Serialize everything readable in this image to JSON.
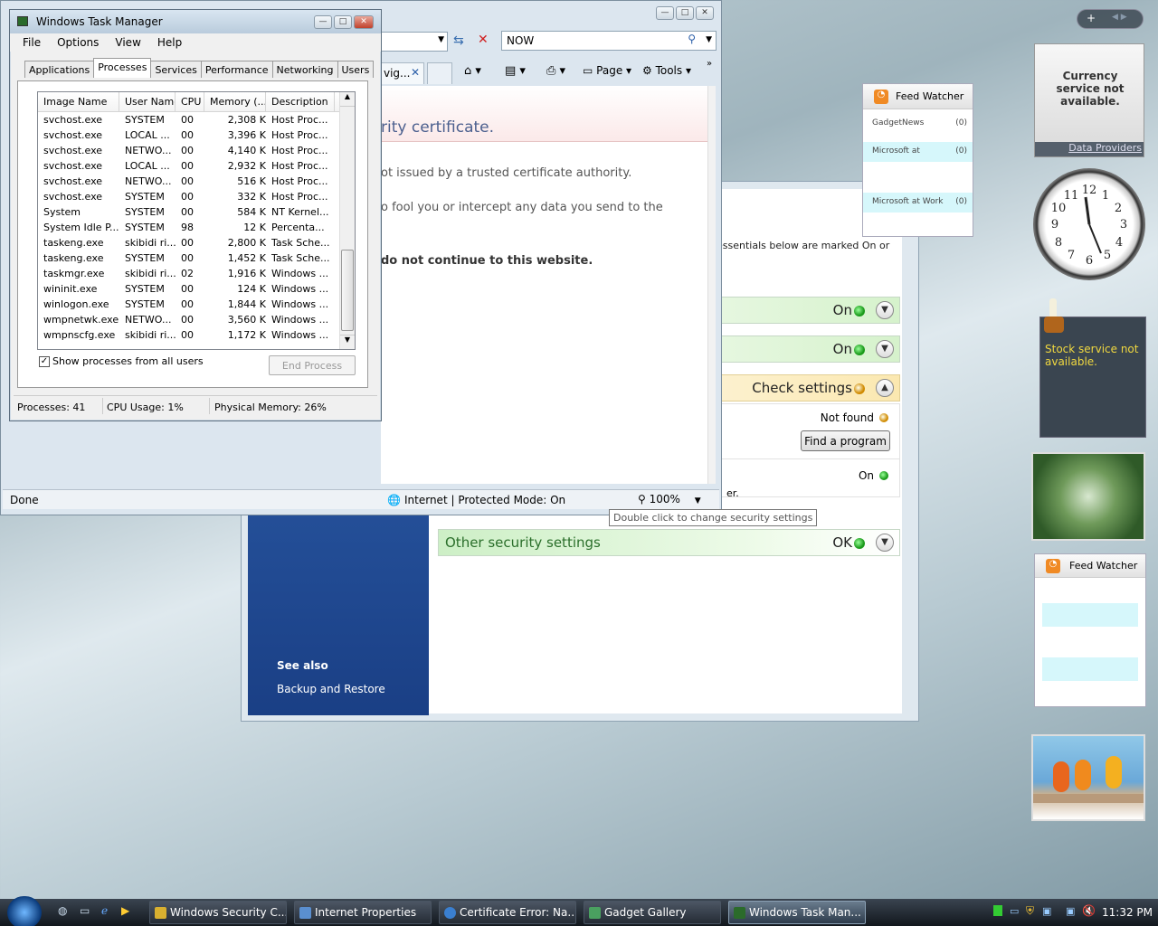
{
  "security_center": {
    "header_fragment": "essentials below are marked On or",
    "rows": [
      {
        "status": "On"
      },
      {
        "status": "On"
      },
      {
        "status": "Check settings"
      }
    ],
    "sub_status_not_found": "Not found",
    "find_program_label": "Find a program",
    "sub_status_on": "On",
    "text_fragment": "er.",
    "other_label": "Other security settings",
    "other_status": "OK",
    "see_also_title": "See also",
    "backup_link": "Backup and Restore"
  },
  "ie": {
    "address_text": "NOW",
    "tab_label": "vig...",
    "toolbar": {
      "page": "Page",
      "tools": "Tools"
    },
    "cert_heading": "rity certificate.",
    "cert_line1": "ot issued by a trusted certificate authority.",
    "cert_line2": "o fool you or intercept any data you send to the",
    "cert_bold": "do not continue to this website.",
    "status_done": "Done",
    "zone": "Internet | Protected Mode: On",
    "zoom": "100%",
    "tooltip": "Double click to change security settings"
  },
  "taskmgr": {
    "title": "Windows Task Manager",
    "menu": [
      "File",
      "Options",
      "View",
      "Help"
    ],
    "tabs": [
      "Applications",
      "Processes",
      "Services",
      "Performance",
      "Networking",
      "Users"
    ],
    "columns": [
      "Image Name",
      "User Name",
      "CPU",
      "Memory (...",
      "Description"
    ],
    "rows": [
      [
        "svchost.exe",
        "SYSTEM",
        "00",
        "2,308 K",
        "Host Proc..."
      ],
      [
        "svchost.exe",
        "LOCAL ...",
        "00",
        "3,396 K",
        "Host Proc..."
      ],
      [
        "svchost.exe",
        "NETWO...",
        "00",
        "4,140 K",
        "Host Proc..."
      ],
      [
        "svchost.exe",
        "LOCAL ...",
        "00",
        "2,932 K",
        "Host Proc..."
      ],
      [
        "svchost.exe",
        "NETWO...",
        "00",
        "516 K",
        "Host Proc..."
      ],
      [
        "svchost.exe",
        "SYSTEM",
        "00",
        "332 K",
        "Host Proc..."
      ],
      [
        "System",
        "SYSTEM",
        "00",
        "584 K",
        "NT Kernel..."
      ],
      [
        "System Idle P...",
        "SYSTEM",
        "98",
        "12 K",
        "Percenta..."
      ],
      [
        "taskeng.exe",
        "skibidi ri...",
        "00",
        "2,800 K",
        "Task Sche..."
      ],
      [
        "taskeng.exe",
        "SYSTEM",
        "00",
        "1,452 K",
        "Task Sche..."
      ],
      [
        "taskmgr.exe",
        "skibidi ri...",
        "02",
        "1,916 K",
        "Windows ..."
      ],
      [
        "wininit.exe",
        "SYSTEM",
        "00",
        "124 K",
        "Windows ..."
      ],
      [
        "winlogon.exe",
        "SYSTEM",
        "00",
        "1,844 K",
        "Windows ..."
      ],
      [
        "wmpnetwk.exe",
        "NETWO...",
        "00",
        "3,560 K",
        "Windows ..."
      ],
      [
        "wmpnscfg.exe",
        "skibidi ri...",
        "00",
        "1,172 K",
        "Windows ..."
      ]
    ],
    "show_all_label": "Show processes from all users",
    "end_process_label": "End Process",
    "status_processes": "Processes: 41",
    "status_cpu": "CPU Usage: 1%",
    "status_memory": "Physical Memory: 26%"
  },
  "gadgets": {
    "feed1_title": "Feed Watcher",
    "feed1_items": [
      {
        "name": "GadgetNews",
        "count": "(0)"
      },
      {
        "name": "Microsoft at",
        "count": "(0)"
      },
      {
        "name": "Microsoft at Work",
        "count": "(0)"
      }
    ],
    "currency_msg": "Currency service not available.",
    "data_providers": "Data Providers",
    "stock_msg": "Stock service not available.",
    "feed2_title": "Feed Watcher"
  },
  "taskbar": {
    "buttons": [
      {
        "label": "Windows Security C..."
      },
      {
        "label": "Internet Properties"
      },
      {
        "label": "Certificate Error: Na..."
      },
      {
        "label": "Gadget Gallery"
      },
      {
        "label": "Windows Task Man..."
      }
    ],
    "clock": "11:32 PM"
  }
}
